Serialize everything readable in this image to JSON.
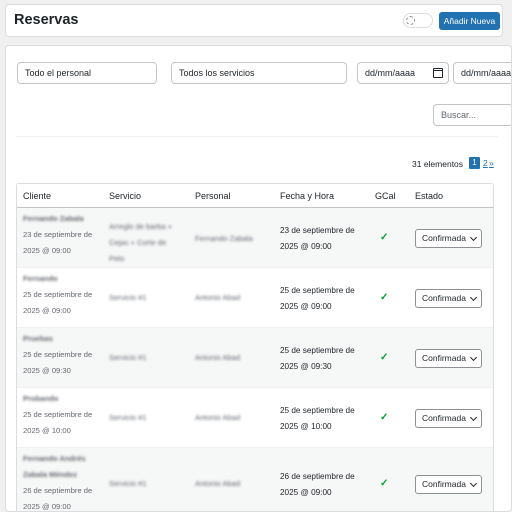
{
  "header": {
    "title": "Reservas",
    "add_label": "Añadir Nueva"
  },
  "filters": {
    "staff": "Todo el personal",
    "services": "Todos los servicios",
    "date_from": "dd/mm/aaaa",
    "date_to": "dd/mm/aaaa",
    "search_placeholder": "Buscar..."
  },
  "pagination": {
    "count": "31 elementos",
    "current": "1",
    "next_page": "2",
    "next_arrow": "»"
  },
  "columns": {
    "client": "Cliente",
    "service": "Servicio",
    "staff": "Personal",
    "datetime": "Fecha y Hora",
    "gcal": "GCal",
    "status": "Estado"
  },
  "rows": [
    {
      "client": "Fernando Zabala",
      "client_date": "23 de septiembre de",
      "client_time": "2025 @ 09:00",
      "service_lines": [
        "Arreglo de barba +",
        "Cejas + Corte de",
        "Pelo"
      ],
      "staff": "Fernando Zabala",
      "datetime_1": "23 de septiembre de",
      "datetime_2": "2025 @ 09:00",
      "gcal": "✓",
      "status": "Confirmada"
    },
    {
      "client": "Fernando",
      "client_date": "25 de septiembre de",
      "client_time": "2025 @ 09:00",
      "service_lines": [
        "Servicio #1"
      ],
      "staff": "Antonio Abad",
      "datetime_1": "25 de septiembre de",
      "datetime_2": "2025 @ 09:00",
      "gcal": "✓",
      "status": "Confirmada"
    },
    {
      "client": "Pruebas",
      "client_date": "25 de septiembre de",
      "client_time": "2025 @ 09:30",
      "service_lines": [
        "Servicio #1"
      ],
      "staff": "Antonio Abad",
      "datetime_1": "25 de septiembre de",
      "datetime_2": "2025 @ 09:30",
      "gcal": "✓",
      "status": "Confirmada"
    },
    {
      "client": "Probando",
      "client_date": "25 de septiembre de",
      "client_time": "2025 @ 10:00",
      "service_lines": [
        "Servicio #1"
      ],
      "staff": "Antonio Abad",
      "datetime_1": "25 de septiembre de",
      "datetime_2": "2025 @ 10:00",
      "gcal": "✓",
      "status": "Confirmada"
    },
    {
      "client": "Fernando Andrés Zabala Méndez",
      "client_date": "26 de septiembre de",
      "client_time": "2025 @ 09:00",
      "service_lines": [
        "Servicio #1"
      ],
      "staff": "Antonio Abad",
      "datetime_1": "26 de septiembre de",
      "datetime_2": "2025 @ 09:00",
      "gcal": "✓",
      "status": "Confirmada"
    }
  ]
}
